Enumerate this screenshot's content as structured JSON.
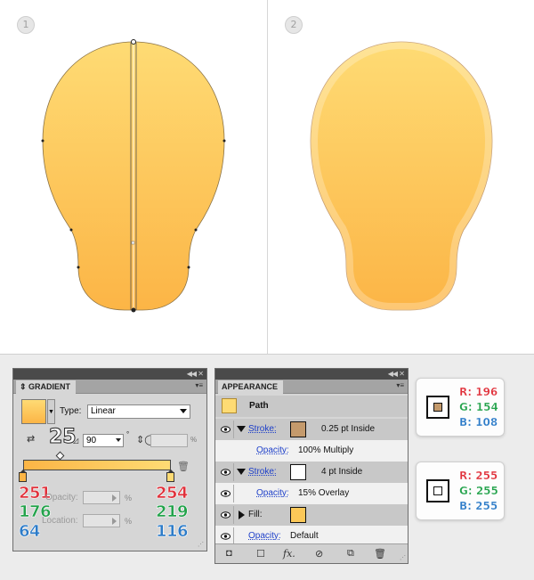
{
  "steps": [
    "1",
    "2"
  ],
  "colors": {
    "shape_top": "#fedb74",
    "shape_bottom": "#fcb546",
    "shape_outline": "#c49a6c",
    "stroke_brown": "#c49a6c",
    "red": "#e0303a",
    "green": "#22a24a",
    "blue": "#2c7bc8"
  },
  "gradient": {
    "title": "GRADIENT",
    "type_label": "Type:",
    "type_value": "Linear",
    "angle_big_label": "25",
    "angle_value": "90",
    "degree": "°",
    "ratio_pct": "%",
    "opacity_label": "Opacity:",
    "location_label": "Location:",
    "pct": "%",
    "left_stop": {
      "r": "251",
      "g": "176",
      "b": "64"
    },
    "right_stop": {
      "r": "254",
      "g": "219",
      "b": "116"
    }
  },
  "appearance": {
    "title": "APPEARANCE",
    "header": "Path",
    "stroke1_label": "Stroke:",
    "stroke1_value": "0.25 pt  Inside",
    "opacity1_label": "Opacity:",
    "opacity1_value": "100% Multiply",
    "stroke2_label": "Stroke:",
    "stroke2_value": "4 pt  Inside",
    "opacity2_label": "Opacity:",
    "opacity2_value": "15% Overlay",
    "fill_label": "Fill:",
    "opacity3_label": "Opacity:",
    "opacity3_value": "Default"
  },
  "color_boxes": [
    {
      "r": "R: 196",
      "g": "G: 154",
      "b": "B: 108",
      "inner_color": "#c49a6c"
    },
    {
      "r": "R: 255",
      "g": "G: 255",
      "b": "B: 255",
      "inner_color": "#ffffff"
    }
  ]
}
